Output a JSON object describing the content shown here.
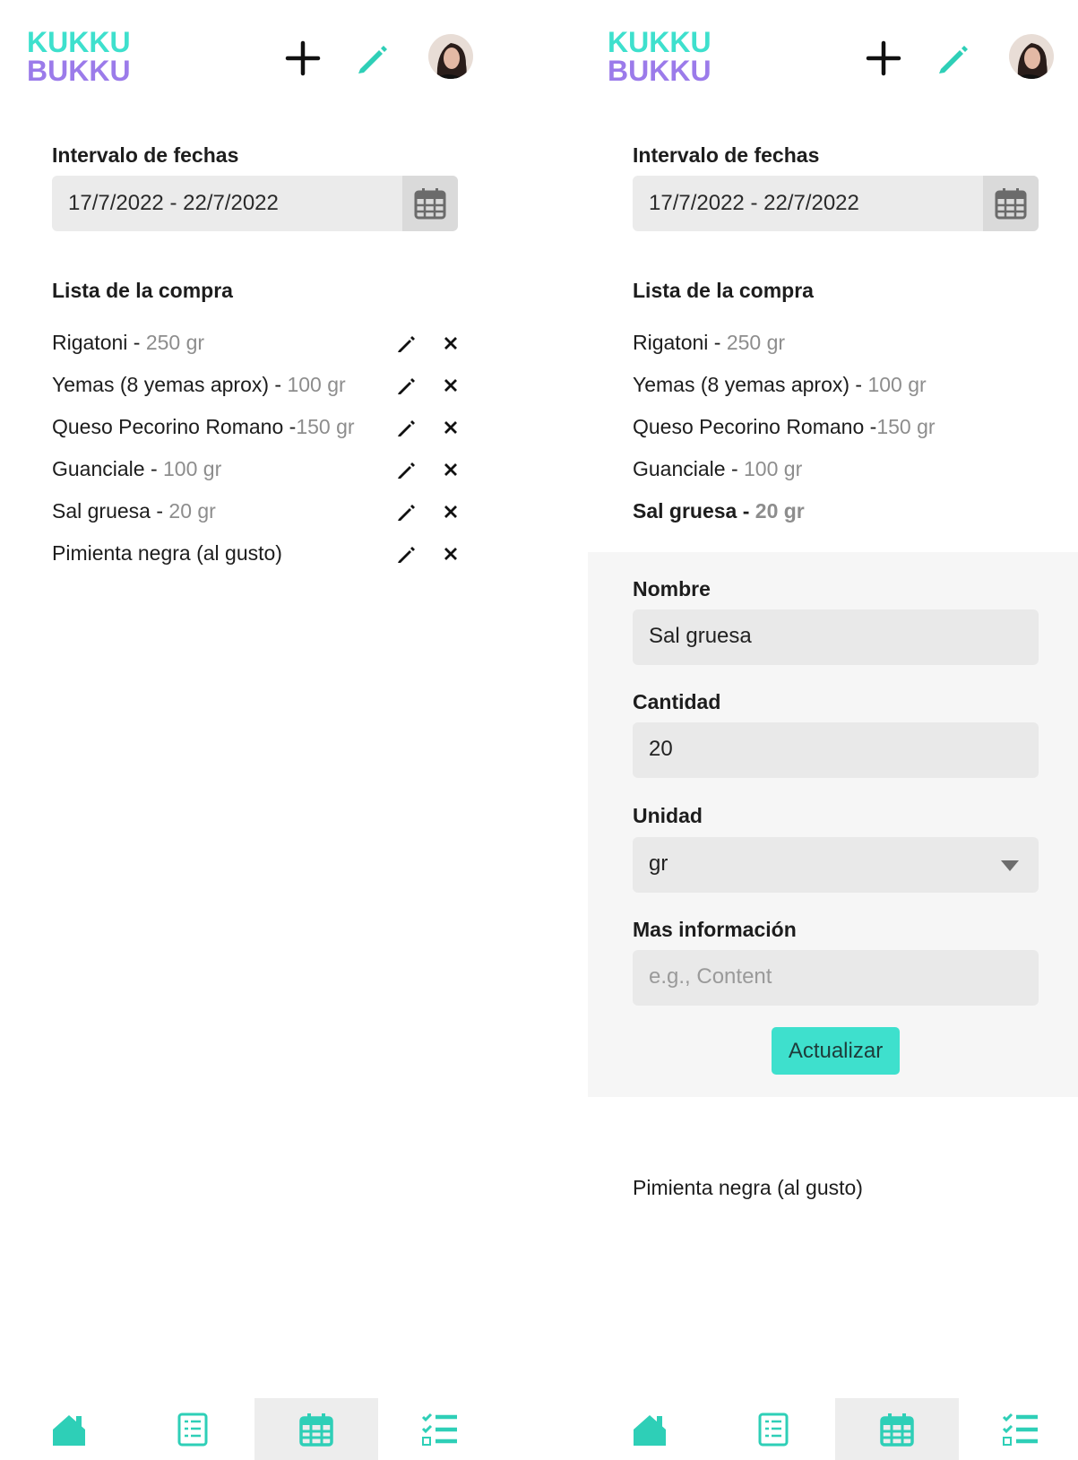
{
  "app": {
    "logo_text": "KUKKU BUKKU",
    "accent": "#3ee0cd",
    "logo_purple": "#9b7bea",
    "logo_teal": "#3ee0cd"
  },
  "screen_a": {
    "header": {
      "icons": [
        "plus-icon",
        "pencil-icon",
        "avatar"
      ]
    },
    "date_range": {
      "label": "Intervalo de fechas",
      "value": "17/7/2022 - 22/7/2022"
    },
    "list": {
      "title": "Lista de la compra",
      "items": [
        {
          "name": "Rigatoni - ",
          "qty": "250 gr"
        },
        {
          "name": "Yemas (8 yemas aprox) - ",
          "qty": "100 gr"
        },
        {
          "name": "Queso Pecorino Romano -",
          "qty": "150 gr"
        },
        {
          "name": "Guanciale - ",
          "qty": "100 gr"
        },
        {
          "name": "Sal gruesa - ",
          "qty": "20 gr"
        },
        {
          "name": "Pimienta negra (al gusto)",
          "qty": ""
        }
      ]
    },
    "nav": {
      "items": [
        "home-icon",
        "recipes-list-icon",
        "calendar-icon",
        "checklist-icon"
      ],
      "active": 2
    }
  },
  "screen_b": {
    "header": {
      "icons": [
        "plus-icon",
        "pencil-icon",
        "avatar"
      ]
    },
    "date_range": {
      "label": "Intervalo de fechas",
      "value": "17/7/2022 - 22/7/2022"
    },
    "list": {
      "title": "Lista de la compra",
      "items": [
        {
          "name": "Rigatoni - ",
          "qty": "250 gr"
        },
        {
          "name": "Yemas (8 yemas aprox) - ",
          "qty": "100 gr"
        },
        {
          "name": "Queso Pecorino Romano -",
          "qty": "150 gr"
        },
        {
          "name": "Guanciale - ",
          "qty": "100 gr"
        },
        {
          "name": "Sal gruesa - ",
          "qty": "20 gr"
        }
      ],
      "after_form": {
        "name": "Pimienta negra (al gusto)"
      }
    },
    "form": {
      "name_label": "Nombre",
      "name_value": "Sal gruesa",
      "qty_label": "Cantidad",
      "qty_value": "20",
      "unit_label": "Unidad",
      "unit_value": "gr",
      "info_label": "Mas información",
      "info_placeholder": "e.g., Content",
      "submit_label": "Actualizar"
    },
    "nav": {
      "items": [
        "home-icon",
        "recipes-list-icon",
        "calendar-icon",
        "checklist-icon"
      ],
      "active": 2
    }
  }
}
